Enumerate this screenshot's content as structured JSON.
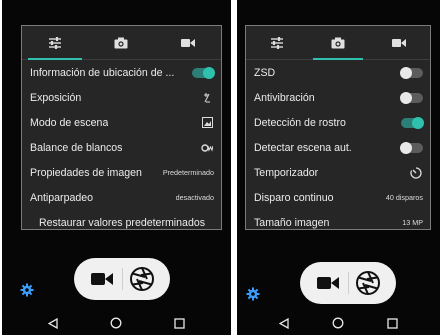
{
  "colors": {
    "accent": "#2fc1ad",
    "panel": "#262626",
    "screen": "#060606",
    "text": "#ececec"
  },
  "left": {
    "tabs": [
      {
        "icon": "adjust-sliders-icon",
        "active": true
      },
      {
        "icon": "camera-icon",
        "active": false
      },
      {
        "icon": "video-camera-icon",
        "active": false
      }
    ],
    "rows": [
      {
        "label": "Información de ubicación de ...",
        "control": "toggle-on"
      },
      {
        "label": "Exposición",
        "control": "exposure-icon"
      },
      {
        "label": "Modo de escena",
        "control": "scene-icon"
      },
      {
        "label": "Balance de blancos",
        "control": "white-balance-icon"
      },
      {
        "label": "Propiedades de imagen",
        "value": "Predeterminado"
      },
      {
        "label": "Antiparpadeo",
        "value": "desactivado"
      }
    ],
    "restore_label": "Restaurar valores predeterminados"
  },
  "right": {
    "tabs": [
      {
        "icon": "adjust-sliders-icon",
        "active": false
      },
      {
        "icon": "camera-icon",
        "active": true
      },
      {
        "icon": "video-camera-icon",
        "active": false
      }
    ],
    "rows": [
      {
        "label": "ZSD",
        "control": "toggle-off"
      },
      {
        "label": "Antivibración",
        "control": "toggle-off"
      },
      {
        "label": "Detección de rostro",
        "control": "toggle-on"
      },
      {
        "label": "Detectar escena aut.",
        "control": "toggle-off"
      },
      {
        "label": "Temporizador",
        "control": "timer-icon"
      },
      {
        "label": "Disparo continuo",
        "value": "40 disparos"
      },
      {
        "label": "Tamaño imagen",
        "value": "13 MP"
      }
    ]
  },
  "bottom": {
    "mode_buttons": [
      "video-mode-icon",
      "shutter-aperture-icon"
    ],
    "settings_icon": "settings-gear-icon",
    "nav": [
      "back-icon",
      "home-icon",
      "recents-icon"
    ]
  }
}
